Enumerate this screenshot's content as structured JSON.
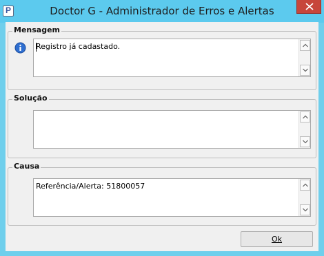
{
  "window": {
    "title": "Doctor G - Administrador de Erros e Alertas",
    "app_icon_glyph": "P",
    "accent_color": "#5ccaee",
    "close_color": "#c7463b"
  },
  "groups": {
    "mensagem": {
      "label": "Mensagem",
      "text": "Registro já cadastado.",
      "icon": "info-icon"
    },
    "solucao": {
      "label": "Solução",
      "text": ""
    },
    "causa": {
      "label": "Causa",
      "text": "Referência/Alerta: 51800057"
    }
  },
  "buttons": {
    "ok_label": "Ok"
  }
}
